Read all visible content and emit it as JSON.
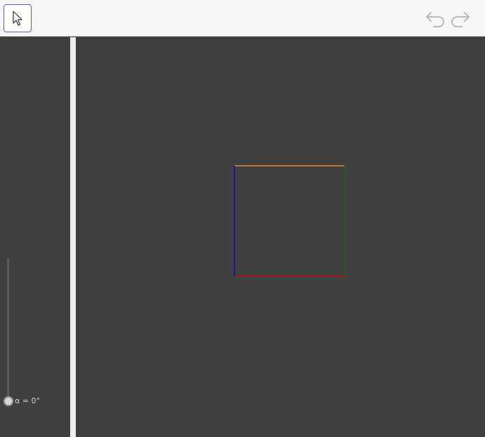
{
  "toolbar": {
    "tools": [
      {
        "name": "move-tool",
        "icon": "arrow-cursor-icon",
        "selected": true
      }
    ],
    "undo_icon": "undo-icon",
    "redo_icon": "redo-icon"
  },
  "slider": {
    "label": "α = 0°",
    "value": 0,
    "unit": "degrees"
  },
  "colors": {
    "background": "#404040",
    "toolbar": "#f7f7f7",
    "selected_tool_border": "#6557d2",
    "edge_top": "#c8702a",
    "edge_right": "#1e5c1e",
    "edge_bottom": "#a01818",
    "edge_left": "#1a1ab0"
  },
  "square_edges": [
    {
      "name": "edge-top",
      "color": "#c8702a"
    },
    {
      "name": "edge-right",
      "color": "#1e5c1e"
    },
    {
      "name": "edge-bottom",
      "color": "#a01818"
    },
    {
      "name": "edge-left",
      "color": "#1a1ab0"
    }
  ]
}
